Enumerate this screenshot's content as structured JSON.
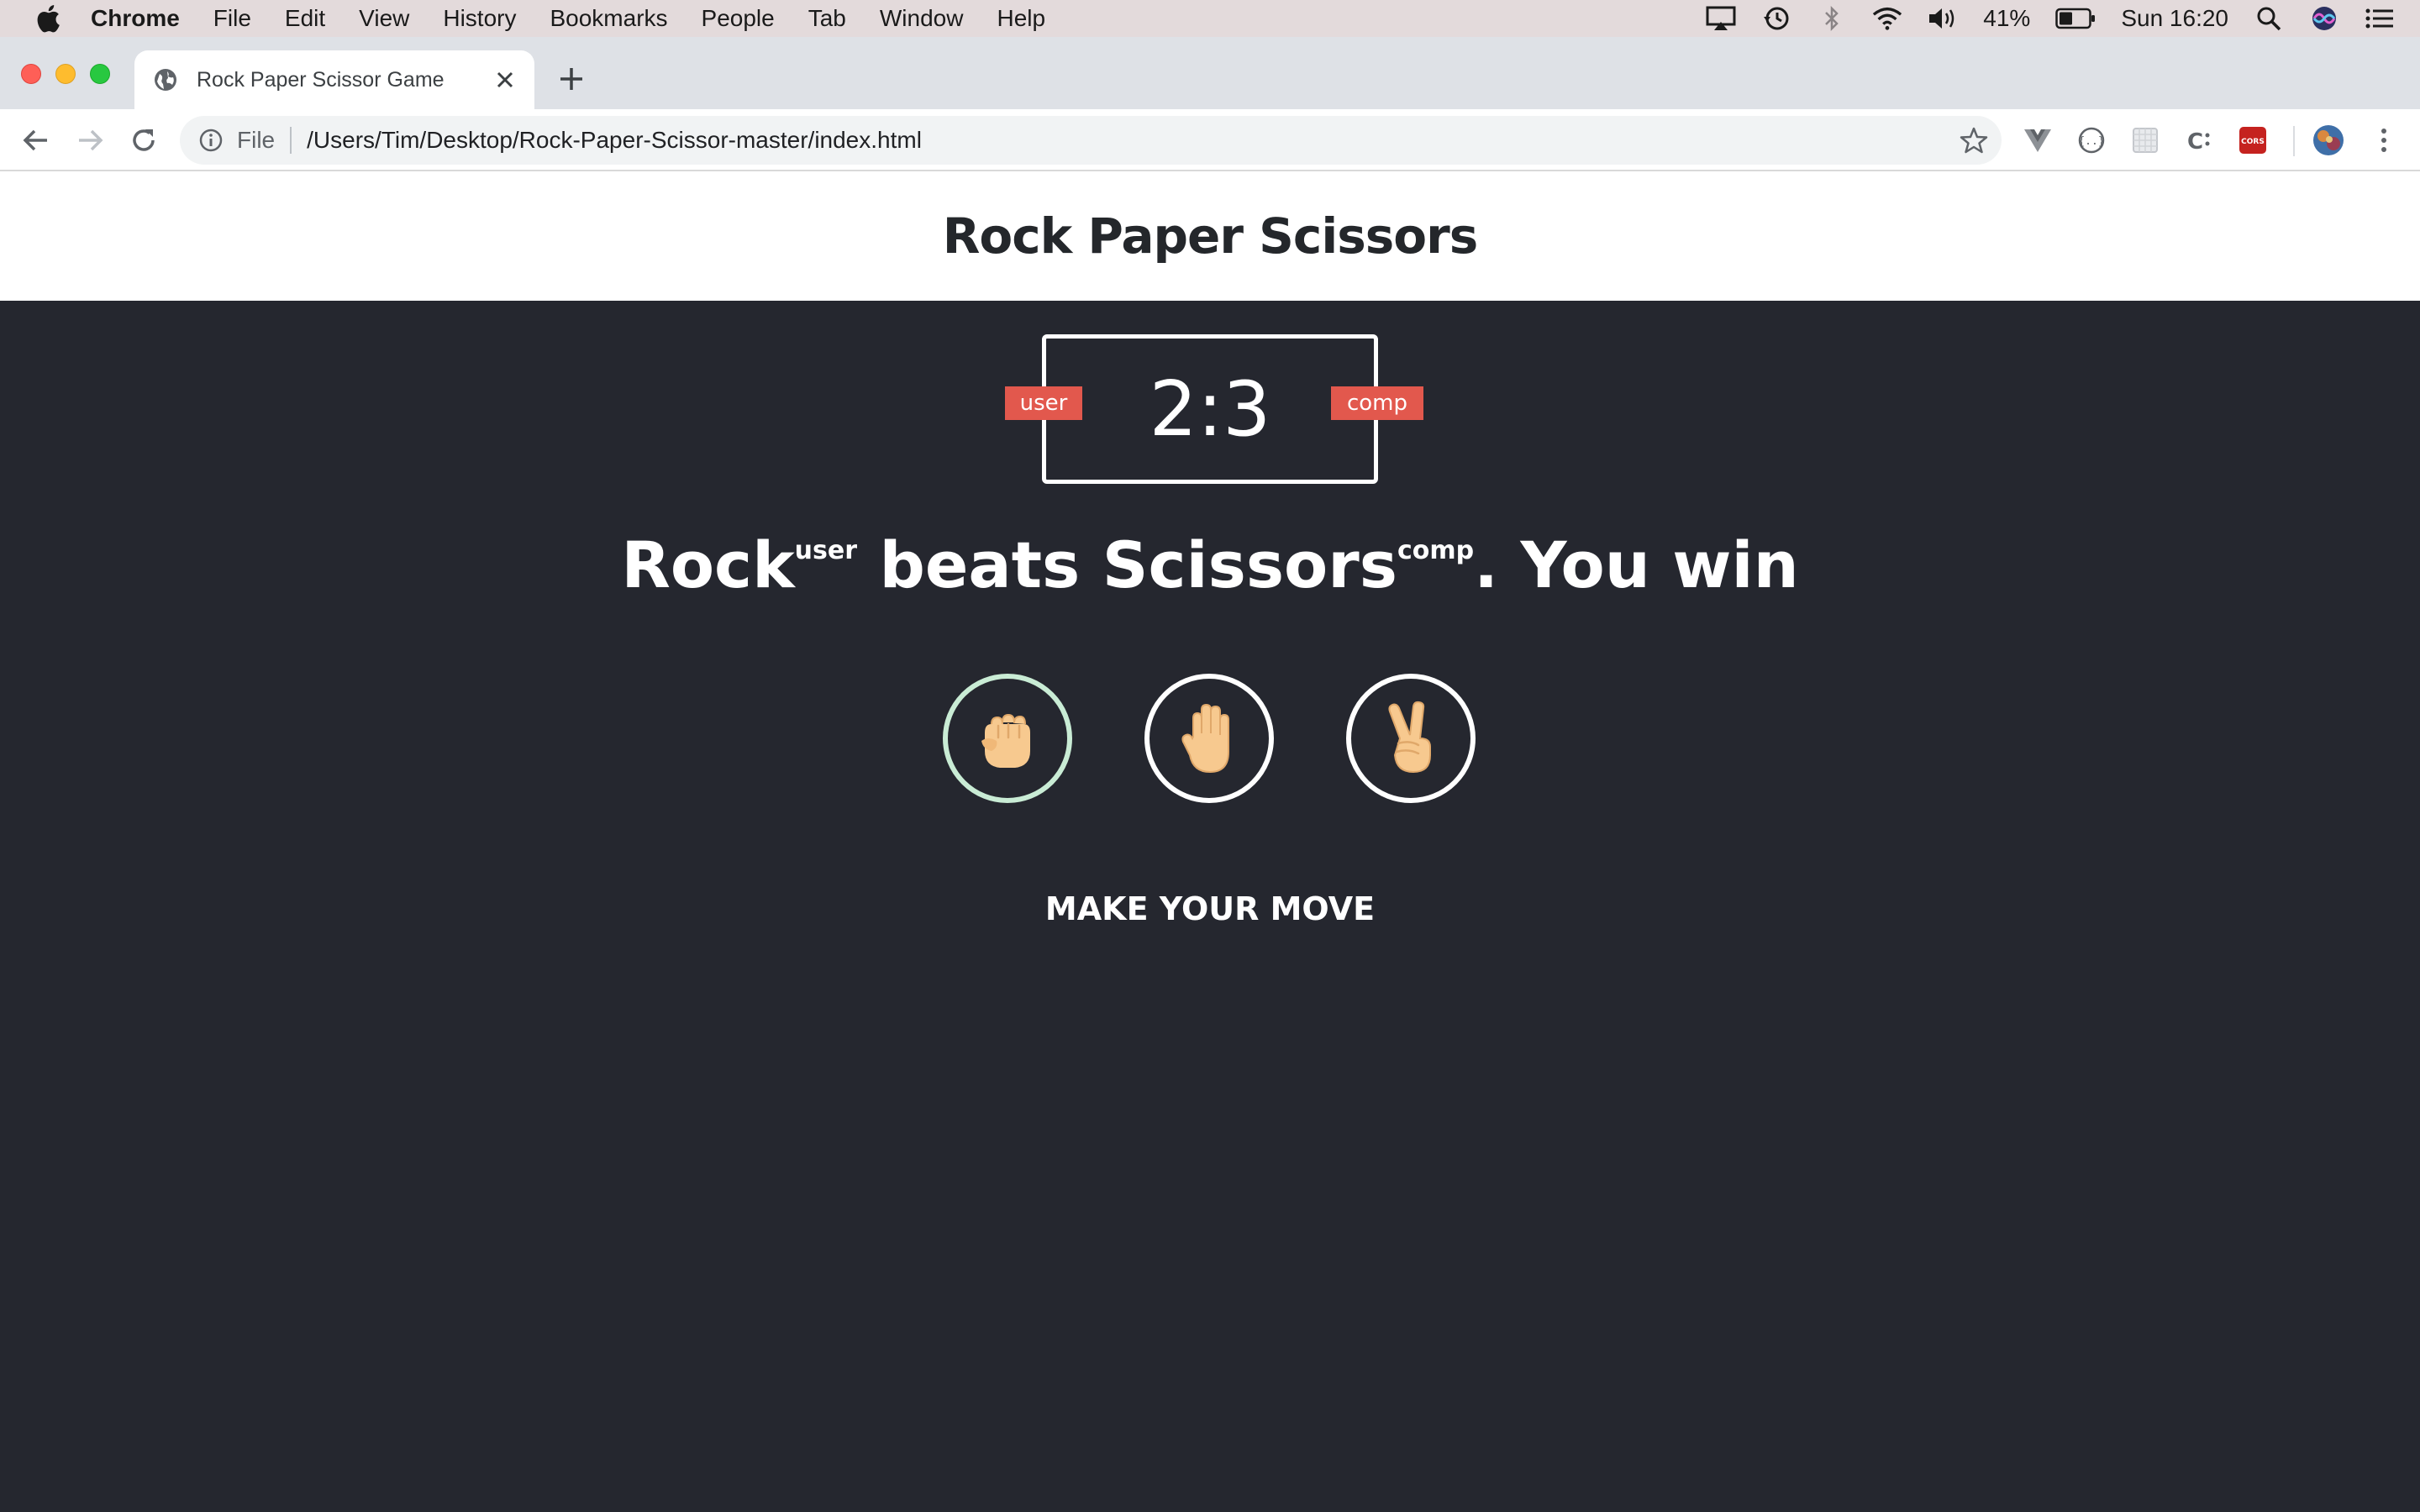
{
  "menubar": {
    "app_name": "Chrome",
    "items": [
      "File",
      "Edit",
      "View",
      "History",
      "Bookmarks",
      "People",
      "Tab",
      "Window",
      "Help"
    ],
    "battery_percent": "41%",
    "clock": "Sun 16:20"
  },
  "browser": {
    "tab_title": "Rock Paper Scissor Game",
    "scheme_label": "File",
    "url": "/Users/Tim/Desktop/Rock-Paper-Scissor-master/index.html",
    "cors_extension_label": "CORS"
  },
  "page": {
    "title": "Rock Paper Scissors",
    "scoreboard": {
      "score": "2:3",
      "user_label": "user",
      "comp_label": "comp"
    },
    "result": {
      "user_choice": "Rock",
      "user_tag": "user",
      "verb": "beats",
      "comp_choice": "Scissors",
      "comp_tag": "comp",
      "outcome": ". You win"
    },
    "choices": [
      {
        "name": "rock",
        "icon": "fist-hand-icon",
        "selected": true
      },
      {
        "name": "paper",
        "icon": "open-hand-icon",
        "selected": false
      },
      {
        "name": "scissors",
        "icon": "victory-hand-icon",
        "selected": false
      }
    ],
    "action_text": "MAKE YOUR MOVE"
  },
  "colors": {
    "game_background": "#25272f",
    "badge": "#e2584d",
    "selected_ring": "#c9ecd5",
    "skin": "#f7c98f"
  }
}
